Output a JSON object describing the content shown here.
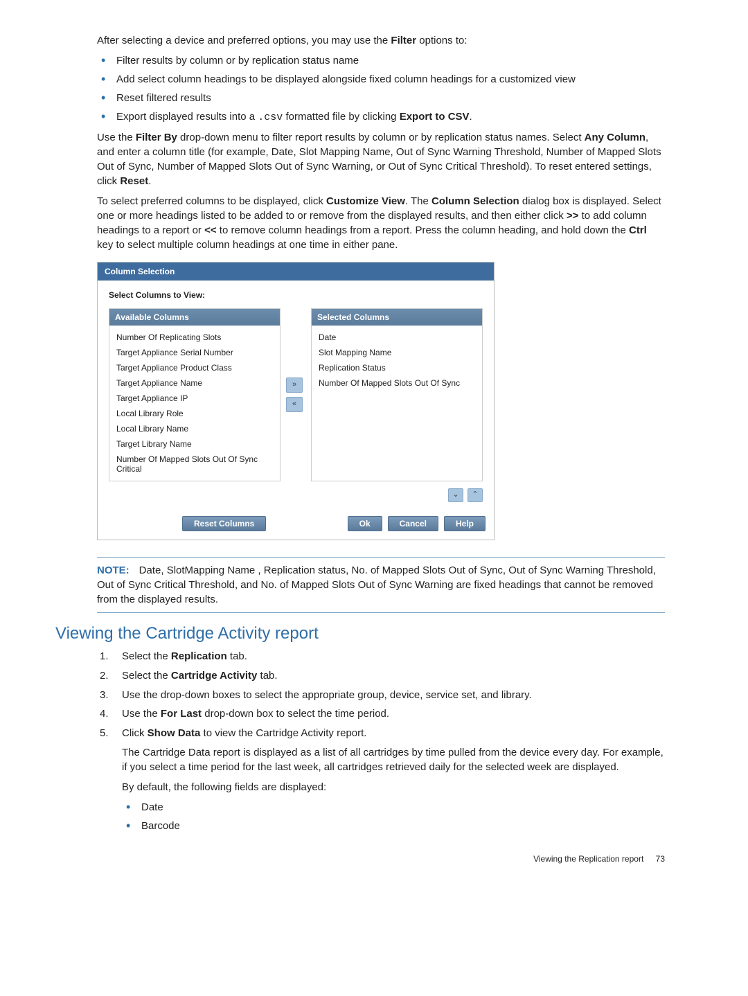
{
  "intro": "After selecting a device and preferred options, you may use the ",
  "intro_bold": "Filter",
  "intro_tail": " options to:",
  "bullets_top": [
    "Filter results by column or by replication status name",
    "Add select column headings to be displayed alongside fixed column headings for a customized view",
    "Reset filtered results"
  ],
  "bullet_export_pre": "Export displayed results into a ",
  "bullet_export_code": ".csv",
  "bullet_export_mid": " formatted file by clicking ",
  "bullet_export_bold": "Export to CSV",
  "bullet_export_end": ".",
  "para_filterby": {
    "a": "Use the ",
    "b": "Filter By",
    "c": " drop-down menu to filter report results by column or by replication status names. Select ",
    "d": "Any Column",
    "e": ", and enter a column title (for example, Date, Slot Mapping Name, Out of Sync Warning Threshold, Number of Mapped Slots Out of Sync, Number of Mapped Slots Out of Sync Warning, or Out of Sync Critical Threshold). To reset entered settings, click ",
    "f": "Reset",
    "g": "."
  },
  "para_customize": {
    "a": "To select preferred columns to be displayed, click ",
    "b": "Customize View",
    "c": ". The ",
    "d": "Column Selection",
    "e": " dialog box is displayed. Select one or more headings listed to be added to or remove from the displayed results, and then either click ",
    "f": ">>",
    "g": " to add column headings to a report or ",
    "h": "<<",
    "i": " to remove column headings from a report. Press the column heading, and hold down the ",
    "j": "Ctrl",
    "k": " key to select multiple column headings at one time in either pane."
  },
  "dialog": {
    "title": "Column Selection",
    "subtitle": "Select Columns to View:",
    "available_header": "Available Columns",
    "selected_header": "Selected Columns",
    "available": [
      "Number Of Replicating Slots",
      "Target Appliance Serial Number",
      "Target Appliance Product Class",
      "Target Appliance Name",
      "Target Appliance IP",
      "Local Library Role",
      "Local Library Name",
      "Target Library Name",
      "Number Of Mapped Slots Out Of Sync Critical"
    ],
    "selected": [
      "Date",
      "Slot Mapping Name",
      "Replication Status",
      "Number Of Mapped Slots Out Of Sync"
    ],
    "arrow_right": "»",
    "arrow_left": "«",
    "arrow_down": "⌄",
    "arrow_up": "⌃",
    "btn_reset": "Reset Columns",
    "btn_ok": "Ok",
    "btn_cancel": "Cancel",
    "btn_help": "Help"
  },
  "note_label": "NOTE:",
  "note_text": "Date, SlotMapping Name , Replication status, No. of Mapped Slots Out of Sync, Out of Sync Warning Threshold, Out of Sync Critical Threshold, and No. of Mapped Slots Out of Sync Warning are fixed headings that cannot be removed from the displayed results.",
  "section_heading": "Viewing the Cartridge Activity report",
  "steps": {
    "s1_a": "Select the ",
    "s1_b": "Replication",
    "s1_c": " tab.",
    "s2_a": "Select the ",
    "s2_b": "Cartridge Activity",
    "s2_c": " tab.",
    "s3": "Use the drop-down boxes to select the appropriate group, device, service set, and library.",
    "s4_a": "Use the ",
    "s4_b": "For Last",
    "s4_c": " drop-down box to select the time period.",
    "s5_a": "Click ",
    "s5_b": "Show Data",
    "s5_c": " to view the Cartridge Activity report.",
    "s5_p": "The Cartridge Data report is displayed as a list of all cartridges by time pulled from the device every day. For example, if you select a time period for the last week, all cartridges retrieved daily for the selected week are displayed.",
    "s5_p2": "By default, the following fields are displayed:",
    "s5_bullets": [
      "Date",
      "Barcode"
    ]
  },
  "footer_text": "Viewing the Replication report",
  "footer_page": "73"
}
